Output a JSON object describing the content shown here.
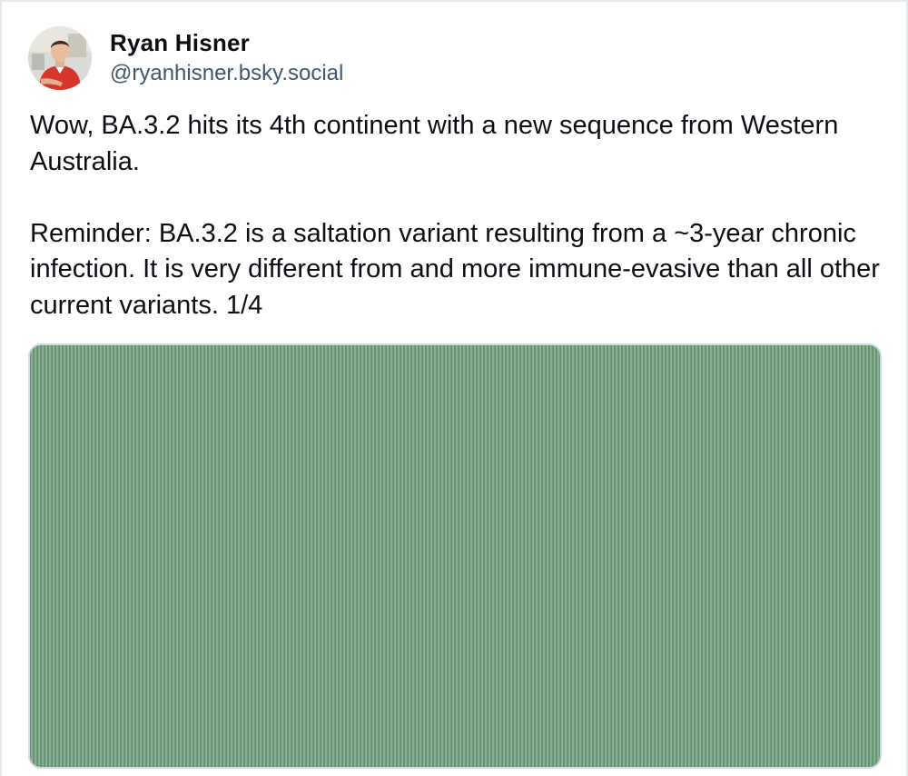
{
  "author": {
    "display_name": "Ryan Hisner",
    "handle": "@ryanhisner.bsky.social",
    "avatar_icon": "avatar-photo"
  },
  "post": {
    "paragraphs": [
      "Wow, BA.3.2 hits its 4th continent with a new sequence from Western Australia.",
      "Reminder: BA.3.2 is a saltation variant resulting from a ~3-year chronic infection. It is very different from and more immune-evasive than all other current variants. 1/4"
    ]
  },
  "embed": {
    "type": "image",
    "dominant_color": "#6f9c7d"
  },
  "colors": {
    "text": "#0b0f14",
    "handle": "#42576c",
    "border": "#e6e9ee"
  }
}
